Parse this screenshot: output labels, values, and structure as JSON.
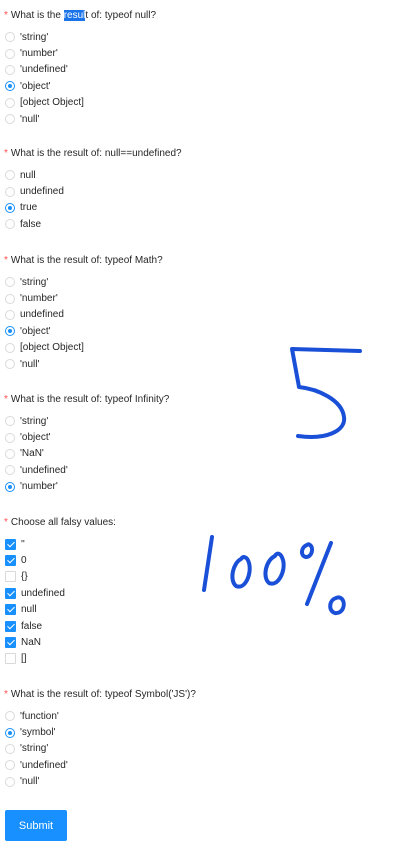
{
  "required_mark": "*",
  "questions": [
    {
      "kind": "radio",
      "title_pre": "What is the ",
      "title_highlight": "resul",
      "title_post": "t of: typeof null?",
      "options": [
        "'string'",
        "'number'",
        "'undefined'",
        "'object'",
        "[object Object]",
        "'null'"
      ],
      "selected": [
        3
      ]
    },
    {
      "kind": "radio",
      "title": "What is the result of: null==undefined?",
      "options": [
        "null",
        "undefined",
        "true",
        "false"
      ],
      "selected": [
        2
      ]
    },
    {
      "kind": "radio",
      "title": "What is the result of: typeof Math?",
      "options": [
        "'string'",
        "'number'",
        "undefined",
        "'object'",
        "[object Object]",
        "'null'"
      ],
      "selected": [
        3
      ]
    },
    {
      "kind": "radio",
      "title": "What is the result of: typeof Infinity?",
      "options": [
        "'string'",
        "'object'",
        "'NaN'",
        "'undefined'",
        "'number'"
      ],
      "selected": [
        4
      ]
    },
    {
      "kind": "checkbox",
      "title": "Choose all falsy values:",
      "options": [
        "''",
        "0",
        "{}",
        "undefined",
        "null",
        "false",
        "NaN",
        "[]"
      ],
      "selected": [
        0,
        1,
        3,
        4,
        5,
        6
      ]
    },
    {
      "kind": "radio",
      "title": "What is the result of: typeof Symbol('JS')?",
      "options": [
        "'function'",
        "'symbol'",
        "'string'",
        "'undefined'",
        "'null'"
      ],
      "selected": [
        1
      ]
    }
  ],
  "submit_label": "Submit",
  "handwritten_annotations": [
    "5",
    "100%"
  ],
  "colors": {
    "primary": "#1890ff",
    "required": "#ff4d4f",
    "text_highlight": "#1a73e8",
    "ink": "#1a4fd8"
  }
}
